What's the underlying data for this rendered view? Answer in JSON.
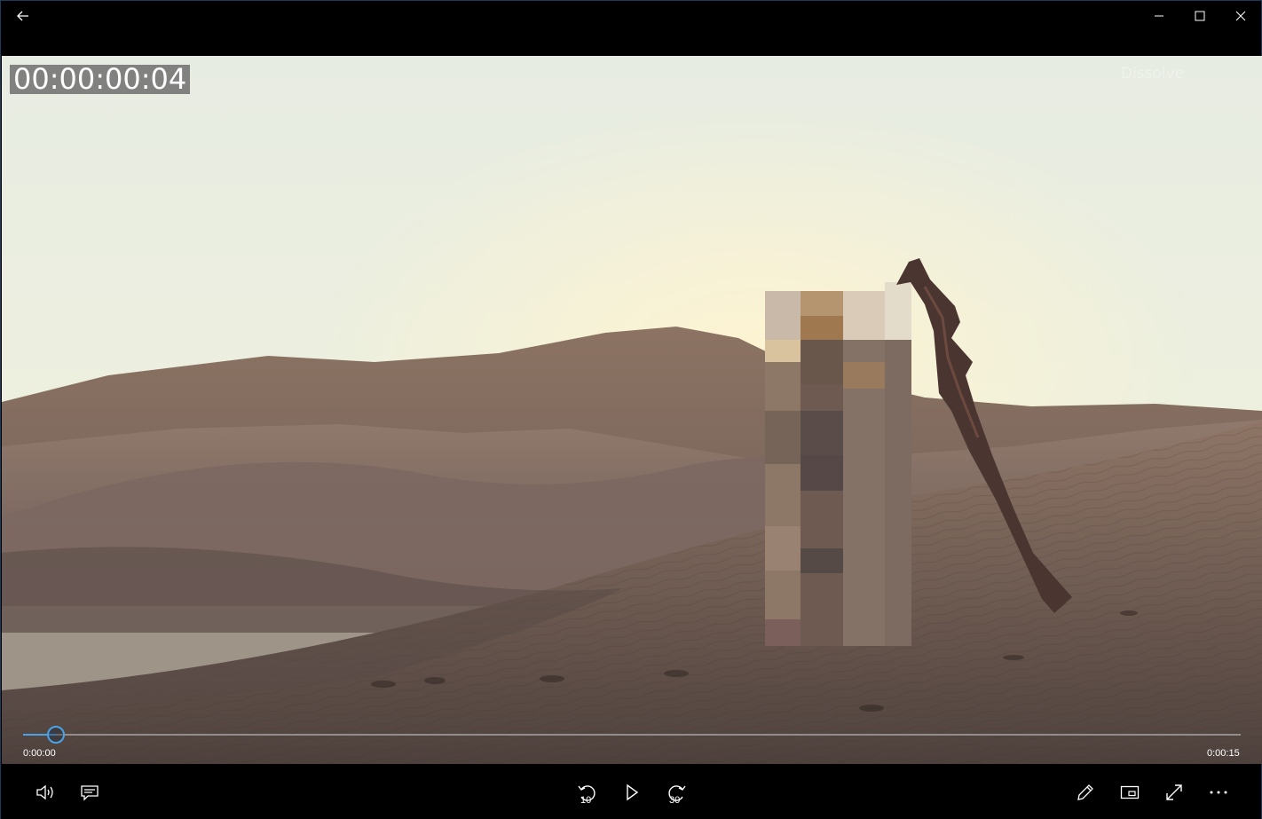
{
  "window": {
    "title_buttons": {
      "back_icon": "arrow-left-icon",
      "minimize_icon": "minimize-icon",
      "maximize_icon": "maximize-icon",
      "close_icon": "close-icon"
    }
  },
  "video": {
    "timecode": "00:00:00:04",
    "watermark": "Dissolve"
  },
  "seek": {
    "elapsed": "0:00:00",
    "total": "0:00:15",
    "progress": 0.027,
    "accent": "#4aa3e8"
  },
  "controls": {
    "volume_icon": "volume-icon",
    "subtitles_icon": "subtitles-icon",
    "skip_back_icon": "skip-back-icon",
    "skip_back_label": "10",
    "play_icon": "play-icon",
    "skip_forward_icon": "skip-forward-icon",
    "skip_forward_label": "30",
    "edit_icon": "pencil-icon",
    "mini_view_icon": "mini-view-icon",
    "fullscreen_icon": "fullscreen-icon",
    "more_icon": "more-icon"
  }
}
